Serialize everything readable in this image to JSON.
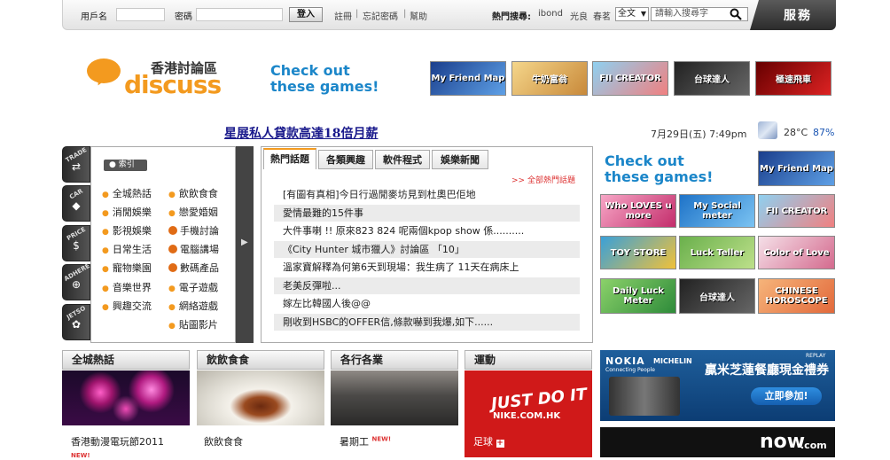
{
  "topbar": {
    "username_label": "用戶名",
    "password_label": "密碼",
    "login_label": "登入",
    "register_label": "註冊",
    "forgot_label": "忘記密碼",
    "help_label": "幫助",
    "hot_search_label": "熱門搜尋:",
    "hot_keywords": [
      "ibond",
      "光良",
      "春茗"
    ],
    "scope_value": "全文",
    "search_placeholder": "請輸入搜尋字",
    "service_label": "服務"
  },
  "logo": {
    "cn": "香港討論區",
    "en": "discuss"
  },
  "games_promo": {
    "line1": "Check out",
    "line2": "these games!"
  },
  "top_games": [
    "My Friend Map",
    "牛奶富翁",
    "FII CREATOR",
    "台球達人",
    "極速飛車"
  ],
  "headline": "星展私人貸款高達18倍月薪",
  "datetime": "7月29日(五) 7:49pm",
  "temperature": "28°C",
  "humidity": "87%",
  "side_tabs": [
    "TRADE",
    "CAR",
    "PRICE",
    "ADHERE",
    "JETSO"
  ],
  "category_badge": "索引",
  "categories_left": [
    "全城熱話",
    "消閒娛樂",
    "影視娛樂",
    "日常生活",
    "寵物樂園",
    "音樂世界",
    "興趣交流"
  ],
  "categories_right": [
    "飲飲食食",
    "戀愛婚姻",
    "手機討論",
    "電腦講場",
    "數碼產品",
    "電子遊戲",
    "網絡遊戲",
    "貼圖影片"
  ],
  "center_tabs": [
    "熱門話題",
    "各類興趣",
    "軟件程式",
    "娛樂新聞"
  ],
  "all_hot_link": ">> 全部熱門話題",
  "news": [
    "[有圖有真相]今日行過閒麥坊見到杜奧巴佢地",
    "愛情最難的15件事",
    "大件事喇 !! 原來823 824 呢兩個kpop show 係..........",
    "《City Hunter 城市獵人》討論區 「10」",
    "溫家寶解釋為何第6天到現場：我生病了 11天在病床上",
    "老美反彈啦...",
    "嫁左比韓國人後@@",
    "剛收到HSBC的OFFER信,條款嚇到我爆,如下......"
  ],
  "right_games": [
    "My Friend Map",
    "Who LOVES u more",
    "My Social meter",
    "FII CREATOR",
    "TOY STORE",
    "Luck Teller",
    "Color of Love",
    "Daily Luck Meter",
    "台球達人",
    "CHINESE HOROSCOPE"
  ],
  "sections": [
    {
      "title": "全城熱話",
      "caption": "香港動漫電玩節2011"
    },
    {
      "title": "飲飲食食",
      "caption": "飲飲食食"
    },
    {
      "title": "各行各業",
      "caption": "暑期工"
    },
    {
      "title": "運動",
      "caption": "足球"
    }
  ],
  "new_badge": "NEW!",
  "nike_ad": {
    "line1": "JUST DO IT",
    "line2": "NIKE.COM.HK"
  },
  "nokia_ad": {
    "brand": "NOKIA",
    "sub": "Connecting People",
    "partner": "MICHELIN",
    "replay": "REPLAY",
    "headline": "贏米芝蓮餐廳現金禮券",
    "cta": "立即參加!"
  },
  "now_ad": {
    "brand": "now",
    "suffix": ".com"
  },
  "colors": {
    "accent": "#f39a1f",
    "link": "#1a1a8c",
    "promo_blue": "#1b86c9"
  }
}
